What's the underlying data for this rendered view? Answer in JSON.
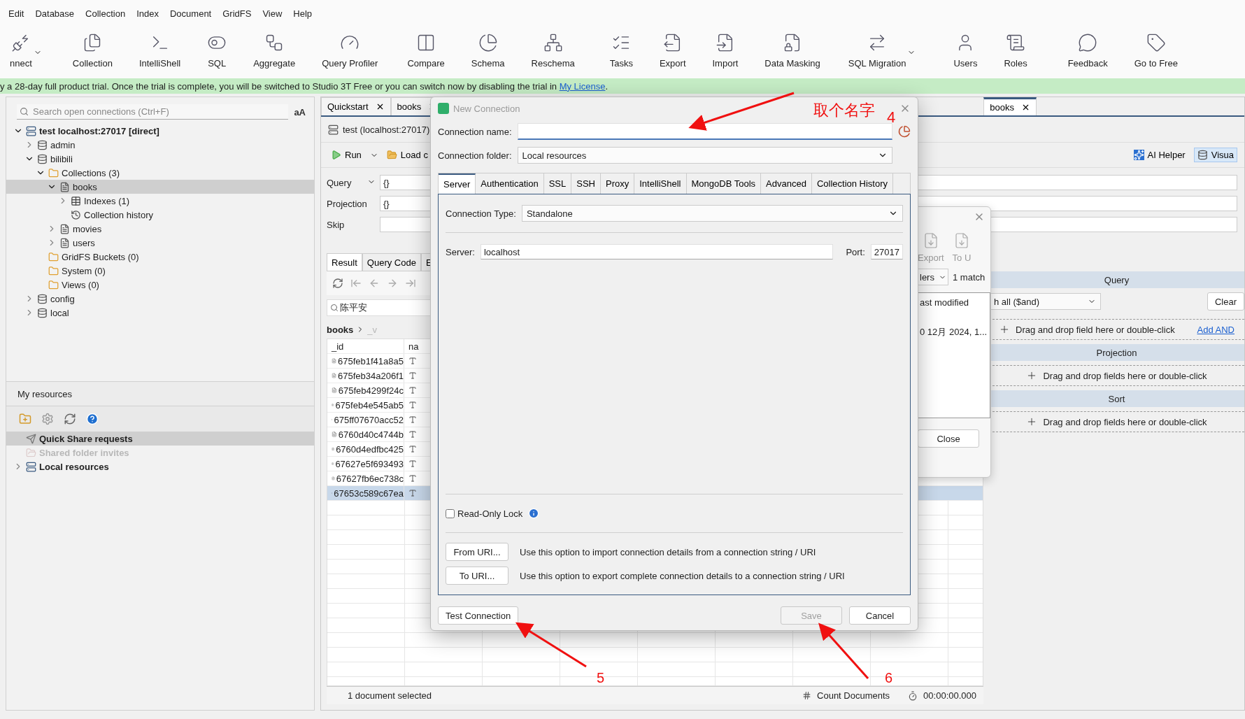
{
  "menu": [
    "Edit",
    "Database",
    "Collection",
    "Index",
    "Document",
    "GridFS",
    "View",
    "Help"
  ],
  "toolbar": [
    {
      "label": "nnect",
      "dropdown": true
    },
    {
      "label": "Collection",
      "dropdown": false
    },
    {
      "label": "IntelliShell",
      "dropdown": false
    },
    {
      "label": "SQL",
      "dropdown": false
    },
    {
      "label": "Aggregate",
      "dropdown": false
    },
    {
      "label": "Query Profiler",
      "dropdown": false
    },
    {
      "label": "Compare",
      "dropdown": false
    },
    {
      "label": "Schema",
      "dropdown": false
    },
    {
      "label": "Reschema",
      "dropdown": false
    },
    {
      "label": "Tasks",
      "dropdown": false
    },
    {
      "label": "Export",
      "dropdown": false
    },
    {
      "label": "Import",
      "dropdown": false
    },
    {
      "label": "Data Masking",
      "dropdown": false
    },
    {
      "label": "SQL Migration",
      "dropdown": true
    },
    {
      "label": "Users",
      "dropdown": false
    },
    {
      "label": "Roles",
      "dropdown": false
    },
    {
      "label": "Feedback",
      "dropdown": false
    },
    {
      "label": "Go to Free",
      "dropdown": false
    }
  ],
  "banner": {
    "text": "y a 28-day full product trial. Once the trial is complete, you will be switched to Studio 3T Free or you can switch now by disabling the trial in ",
    "link": "My License",
    "end": "."
  },
  "connections": {
    "search_placeholder": "Search open connections (Ctrl+F)",
    "case_button": "aA",
    "tree": [
      {
        "label": "test localhost:27017 [direct]",
        "kind": "server",
        "expanded": true,
        "selected": false,
        "children": [
          {
            "label": "admin",
            "kind": "database",
            "expanded": false,
            "selected": false
          },
          {
            "label": "bilibili",
            "kind": "database",
            "expanded": true,
            "selected": false,
            "children": [
              {
                "label": "Collections (3)",
                "kind": "folder",
                "expanded": true,
                "selected": false,
                "children": [
                  {
                    "label": "books",
                    "kind": "collection",
                    "expanded": true,
                    "selected": true,
                    "children": [
                      {
                        "label": "Indexes (1)",
                        "kind": "index",
                        "expanded": false,
                        "selected": false
                      },
                      {
                        "label": "Collection history",
                        "kind": "history",
                        "selected": false
                      }
                    ]
                  },
                  {
                    "label": "movies",
                    "kind": "collection",
                    "expanded": false,
                    "selected": false
                  },
                  {
                    "label": "users",
                    "kind": "collection",
                    "expanded": false,
                    "selected": false
                  }
                ]
              },
              {
                "label": "GridFS Buckets (0)",
                "kind": "folder",
                "selected": false
              },
              {
                "label": "System (0)",
                "kind": "folder",
                "selected": false
              },
              {
                "label": "Views (0)",
                "kind": "folder",
                "selected": false
              }
            ]
          },
          {
            "label": "config",
            "kind": "database",
            "expanded": false,
            "selected": false
          },
          {
            "label": "local",
            "kind": "database",
            "expanded": false,
            "selected": false
          }
        ]
      }
    ]
  },
  "resources": {
    "title": "My resources",
    "items": [
      {
        "label": "Quick Share requests",
        "selected": true,
        "disabled": false
      },
      {
        "label": "Shared folder invites",
        "selected": false,
        "disabled": true
      },
      {
        "label": "Local resources",
        "selected": false,
        "disabled": false,
        "expanded": false
      }
    ]
  },
  "tabs": [
    {
      "label": "Quickstart",
      "selected": false
    },
    {
      "label": "books",
      "selected": false
    },
    {
      "label": "books",
      "selected": true
    }
  ],
  "connection_label": "test (localhost:27017)",
  "actions": {
    "run": "Run",
    "load": "Load c",
    "ai_helper": "AI Helper",
    "visual": "Visua"
  },
  "query_fields": [
    {
      "label": "Query",
      "value": "{}",
      "dropdown": true
    },
    {
      "label": "Projection",
      "value": "{}",
      "dropdown": false
    },
    {
      "label": "Skip",
      "dropdown": false
    }
  ],
  "result_tabs": [
    {
      "label": "Result",
      "selected": true
    },
    {
      "label": "Query Code",
      "selected": false
    },
    {
      "label": "E",
      "selected": false
    }
  ],
  "result_search": "陈平安",
  "breadcrumb": [
    "books",
    "_v"
  ],
  "grid": {
    "columns": [
      "_id",
      "na"
    ],
    "rows": [
      {
        "id": "675feb1f41a8a5",
        "selected": false
      },
      {
        "id": "675feb34a206f1",
        "selected": false
      },
      {
        "id": "675feb4299f24c",
        "selected": false
      },
      {
        "id": "675feb4e545ab5",
        "selected": false
      },
      {
        "id": "675ff07670acc52",
        "selected": false
      },
      {
        "id": "6760d40c4744b",
        "selected": false
      },
      {
        "id": "6760d4edfbc425",
        "selected": false
      },
      {
        "id": "67627e5f693493",
        "selected": false
      },
      {
        "id": "67627fb6ec738c",
        "selected": false
      },
      {
        "id": "67653c589c67ea",
        "selected": true
      }
    ]
  },
  "status": {
    "selection": "1 document selected",
    "count": "Count Documents",
    "time": "00:00:00.000"
  },
  "builder": {
    "match": "h all ($and)",
    "clear": "Clear",
    "sections": [
      {
        "title": "Query",
        "hint": "Drag and drop field here or double-click",
        "link": "Add AND"
      },
      {
        "title": "Projection",
        "hint": "Drag and drop fields here or double-click"
      },
      {
        "title": "Sort",
        "hint": "Drag and drop fields here or double-click"
      }
    ]
  },
  "popup": {
    "buttons": [
      "Export",
      "To U"
    ],
    "filter": "lers",
    "matches": "1 match",
    "column": "ast modified",
    "cell": "0 12月 2024, 1...",
    "close": "Close"
  },
  "dialog": {
    "title": "New Connection",
    "name_label": "Connection name:",
    "folder_label": "Connection folder:",
    "folder": "Local resources",
    "tabs": [
      {
        "label": "Server",
        "selected": true
      },
      {
        "label": "Authentication",
        "selected": false
      },
      {
        "label": "SSL",
        "selected": false
      },
      {
        "label": "SSH",
        "selected": false
      },
      {
        "label": "Proxy",
        "selected": false
      },
      {
        "label": "IntelliShell",
        "selected": false
      },
      {
        "label": "MongoDB Tools",
        "selected": false
      },
      {
        "label": "Advanced",
        "selected": false
      },
      {
        "label": "Collection History",
        "selected": false
      }
    ],
    "type_label": "Connection Type:",
    "type": "Standalone",
    "server_label": "Server:",
    "server": "localhost",
    "port_label": "Port:",
    "port": "27017",
    "read_only": {
      "label": "Read-Only Lock",
      "checked": false
    },
    "uri": [
      {
        "button": "From URI...",
        "text": "Use this option to import connection details from a connection string / URI"
      },
      {
        "button": "To URI...",
        "text": "Use this option to export complete connection details to a connection string / URI"
      }
    ],
    "test": "Test Connection",
    "save": {
      "label": "Save",
      "disabled": true
    },
    "cancel": "Cancel"
  },
  "annotations": [
    "取个名字",
    "4",
    "5",
    "6"
  ]
}
